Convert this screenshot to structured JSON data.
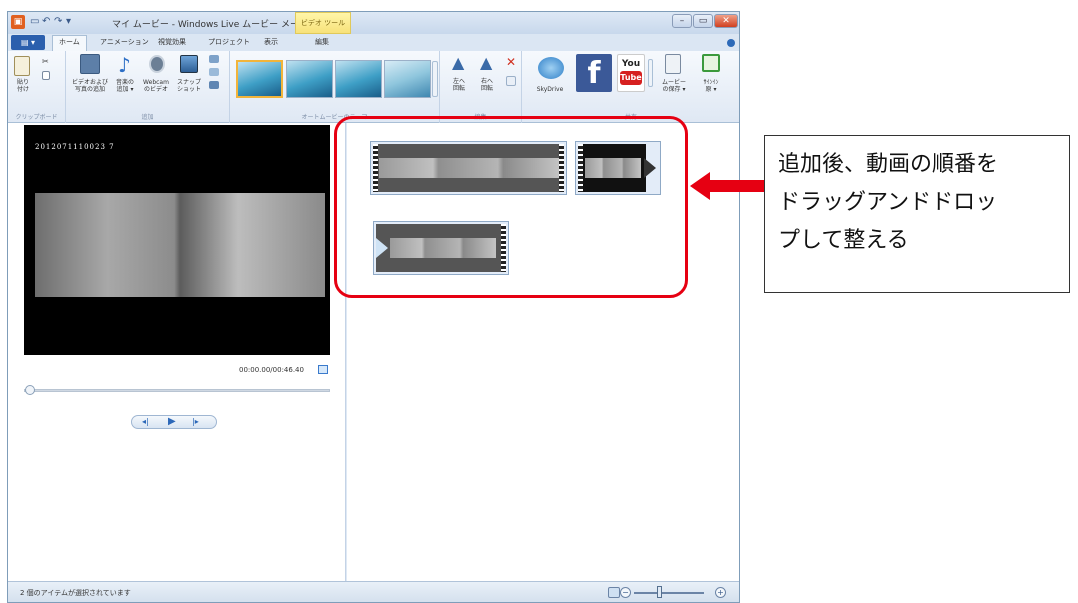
{
  "window": {
    "title": "マイ ムービー - Windows Live ムービー メーカー",
    "context_tab": "ビデオ ツール",
    "window_controls": [
      "minimize",
      "maximize",
      "close"
    ]
  },
  "tabs": [
    "ホーム",
    "アニメーション",
    "視覚効果",
    "プロジェクト",
    "表示",
    "編集"
  ],
  "active_tab": "ホーム",
  "ribbon": {
    "clipboard": {
      "paste": "貼り\n付け",
      "group_label": "クリップボード"
    },
    "add": {
      "add_video_photo": "ビデオおよび\n写真の追加",
      "add_music": "音楽の\n追加 ▾",
      "webcam": "Webcam\nのビデオ",
      "snapshot": "スナップ\nショット",
      "group_label": "追加"
    },
    "themes": {
      "group_label": "オートムービーのテーマ",
      "count": 4
    },
    "edit": {
      "rotate_left": "左へ\n回転",
      "rotate_right": "右へ\n回転",
      "group_label": "編集"
    },
    "share": {
      "skydrive": "SkyDrive",
      "youtube_top": "You",
      "youtube_bottom": "Tube",
      "save_movie": "ムービー\nの保存 ▾",
      "sign_in": "ｻｲﾝｲﾝ\n原 ▾",
      "group_label": "共有"
    }
  },
  "preview": {
    "timestamp": "2012071110023 7",
    "time": "00:00.00/00:46.40",
    "seek_progress": 0.0,
    "controls": [
      "previous-frame",
      "play",
      "next-frame"
    ]
  },
  "storyboard": {
    "clips": [
      {
        "frames": 4
      },
      {
        "frames": 1
      },
      {
        "frames": 2
      }
    ]
  },
  "statusbar": {
    "text": "2 個のアイテムが選択されています",
    "zoom_minus": "−",
    "zoom_plus": "+"
  },
  "annotation": {
    "callout": "追加後、動画の順番を\nドラッグアンドドロッ\nプして整える",
    "highlight_color": "#e60012",
    "arrow_color": "#e60012"
  }
}
